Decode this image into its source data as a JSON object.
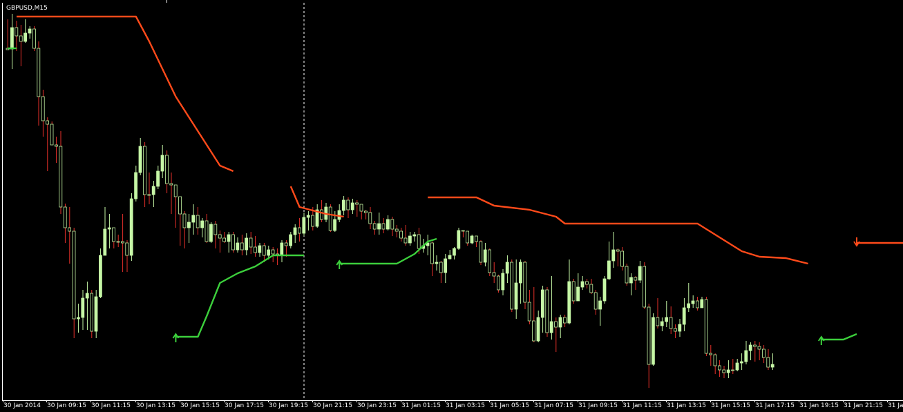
{
  "window": {
    "symbol_label": "GBPUSD,M15"
  },
  "colors": {
    "background": "#000000",
    "bull_candle": "#c6f7a6",
    "bear_candle": "#000000",
    "bull_wick": "#c6f7a6",
    "bear_wick": "#e8302a",
    "trend_down": "#ff4a1a",
    "trend_up": "#3ccf3c",
    "session_line": "#ffffff",
    "axis_text": "#ffffff"
  },
  "chart_data": {
    "type": "candlestick",
    "symbol": "GBPUSD",
    "timeframe": "M15",
    "grid": false,
    "x_tick_labels": [
      "30 Jan 2014",
      "30 Jan 09:15",
      "30 Jan 11:15",
      "30 Jan 13:15",
      "30 Jan 15:15",
      "30 Jan 17:15",
      "30 Jan 19:15",
      "30 Jan 21:15",
      "30 Jan 23:15",
      "31 Jan 01:15",
      "31 Jan 03:15",
      "31 Jan 05:15",
      "31 Jan 07:15",
      "31 Jan 09:15",
      "31 Jan 11:15",
      "31 Jan 13:15",
      "31 Jan 15:15",
      "31 Jan 17:15",
      "31 Jan 19:15",
      "31 Jan 21:15",
      "31 Ja"
    ],
    "y_range": [
      440,
      10
    ],
    "session_separator_bar": 67,
    "candles": [
      [
        70,
        72,
        28,
        71
      ],
      [
        71,
        40,
        20,
        100
      ],
      [
        40,
        52,
        30,
        74
      ],
      [
        52,
        60,
        36,
        96
      ],
      [
        60,
        48,
        28,
        62
      ],
      [
        48,
        42,
        38,
        56
      ],
      [
        42,
        70,
        38,
        74
      ],
      [
        70,
        140,
        60,
        182
      ],
      [
        140,
        175,
        130,
        198
      ],
      [
        175,
        180,
        170,
        248
      ],
      [
        180,
        210,
        176,
        210
      ],
      [
        210,
        212,
        198,
        236
      ],
      [
        212,
        300,
        190,
        310
      ],
      [
        300,
        330,
        295,
        352
      ],
      [
        330,
        335,
        300,
        382
      ],
      [
        335,
        462,
        330,
        490
      ],
      [
        462,
        460,
        440,
        482
      ],
      [
        460,
        432,
        420,
        478
      ],
      [
        432,
        425,
        408,
        478
      ],
      [
        425,
        480,
        420,
        490
      ],
      [
        480,
        430,
        420,
        490
      ],
      [
        430,
        370,
        360,
        432
      ],
      [
        370,
        332,
        300,
        370
      ],
      [
        332,
        330,
        310,
        360
      ],
      [
        330,
        350,
        330,
        360
      ],
      [
        350,
        350,
        340,
        358
      ],
      [
        350,
        352,
        310,
        394
      ],
      [
        352,
        370,
        348,
        394
      ],
      [
        370,
        288,
        280,
        378
      ],
      [
        288,
        250,
        240,
        292
      ],
      [
        250,
        212,
        200,
        254
      ],
      [
        212,
        282,
        206,
        300
      ],
      [
        282,
        282,
        250,
        296
      ],
      [
        282,
        270,
        262,
        300
      ],
      [
        270,
        248,
        240,
        274
      ],
      [
        248,
        225,
        210,
        258
      ],
      [
        225,
        266,
        218,
        280
      ],
      [
        266,
        268,
        250,
        310
      ],
      [
        268,
        285,
        280,
        330
      ],
      [
        285,
        310,
        300,
        356
      ],
      [
        310,
        330,
        306,
        360
      ],
      [
        330,
        322,
        310,
        352
      ],
      [
        322,
        312,
        296,
        340
      ],
      [
        312,
        330,
        300,
        340
      ],
      [
        330,
        320,
        316,
        344
      ],
      [
        320,
        350,
        310,
        352
      ],
      [
        350,
        325,
        322,
        352
      ],
      [
        325,
        340,
        320,
        360
      ],
      [
        340,
        345,
        334,
        366
      ],
      [
        345,
        350,
        336,
        352
      ],
      [
        350,
        340,
        336,
        366
      ],
      [
        340,
        362,
        336,
        366
      ],
      [
        362,
        352,
        344,
        366
      ],
      [
        352,
        362,
        340,
        370
      ],
      [
        362,
        345,
        338,
        370
      ],
      [
        345,
        358,
        336,
        368
      ],
      [
        358,
        366,
        342,
        372
      ],
      [
        366,
        356,
        352,
        372
      ],
      [
        356,
        370,
        352,
        380
      ],
      [
        370,
        362,
        356,
        376
      ],
      [
        362,
        368,
        358,
        380
      ],
      [
        368,
        370,
        360,
        384
      ],
      [
        370,
        352,
        348,
        380
      ],
      [
        352,
        356,
        348,
        372
      ],
      [
        356,
        340,
        336,
        360
      ],
      [
        340,
        330,
        325,
        352
      ],
      [
        330,
        338,
        316,
        350
      ],
      [
        338,
        315,
        308,
        342
      ],
      [
        315,
        312,
        306,
        334
      ],
      [
        312,
        328,
        300,
        334
      ],
      [
        328,
        304,
        296,
        330
      ],
      [
        304,
        318,
        290,
        322
      ],
      [
        318,
        300,
        294,
        322
      ],
      [
        300,
        334,
        296,
        336
      ],
      [
        334,
        318,
        306,
        336
      ],
      [
        318,
        305,
        296,
        322
      ],
      [
        305,
        290,
        284,
        312
      ],
      [
        290,
        304,
        286,
        316
      ],
      [
        304,
        294,
        288,
        310
      ],
      [
        294,
        296,
        290,
        314
      ],
      [
        296,
        306,
        296,
        318
      ],
      [
        306,
        308,
        304,
        318
      ],
      [
        308,
        324,
        300,
        332
      ],
      [
        324,
        332,
        320,
        340
      ],
      [
        332,
        324,
        308,
        340
      ],
      [
        324,
        332,
        316,
        338
      ],
      [
        332,
        318,
        312,
        334
      ],
      [
        318,
        332,
        314,
        342
      ],
      [
        332,
        335,
        326,
        344
      ],
      [
        335,
        345,
        330,
        350
      ],
      [
        345,
        352,
        326,
        356
      ],
      [
        352,
        342,
        336,
        356
      ],
      [
        342,
        340,
        336,
        350
      ],
      [
        340,
        360,
        330,
        368
      ],
      [
        360,
        356,
        346,
        366
      ],
      [
        356,
        352,
        340,
        370
      ],
      [
        352,
        382,
        350,
        400
      ],
      [
        382,
        380,
        370,
        392
      ],
      [
        380,
        395,
        378,
        410
      ],
      [
        395,
        375,
        368,
        410
      ],
      [
        375,
        370,
        362,
        376
      ],
      [
        370,
        360,
        358,
        376
      ],
      [
        360,
        334,
        330,
        362
      ],
      [
        334,
        335,
        334,
        344
      ],
      [
        335,
        352,
        336,
        356
      ],
      [
        352,
        342,
        340,
        354
      ],
      [
        342,
        350,
        346,
        358
      ],
      [
        350,
        380,
        348,
        384
      ],
      [
        380,
        362,
        352,
        386
      ],
      [
        362,
        395,
        360,
        400
      ],
      [
        395,
        400,
        380,
        410
      ],
      [
        400,
        420,
        398,
        424
      ],
      [
        420,
        396,
        390,
        428
      ],
      [
        396,
        380,
        370,
        410
      ],
      [
        380,
        448,
        376,
        452
      ],
      [
        448,
        410,
        376,
        462
      ],
      [
        410,
        380,
        376,
        440
      ],
      [
        380,
        438,
        378,
        448
      ],
      [
        438,
        465,
        420,
        470
      ],
      [
        465,
        494,
        416,
        496
      ],
      [
        494,
        460,
        450,
        496
      ],
      [
        460,
        420,
        414,
        482
      ],
      [
        420,
        482,
        416,
        488
      ],
      [
        482,
        466,
        400,
        492
      ],
      [
        466,
        474,
        460,
        510
      ],
      [
        474,
        460,
        456,
        490
      ],
      [
        460,
        468,
        456,
        474
      ],
      [
        468,
        408,
        376,
        470
      ],
      [
        408,
        436,
        404,
        440
      ],
      [
        436,
        416,
        396,
        436
      ],
      [
        416,
        408,
        400,
        420
      ],
      [
        408,
        412,
        404,
        418
      ],
      [
        412,
        424,
        404,
        426
      ],
      [
        424,
        448,
        420,
        456
      ],
      [
        448,
        436,
        430,
        472
      ],
      [
        436,
        404,
        400,
        440
      ],
      [
        404,
        378,
        350,
        406
      ],
      [
        378,
        362,
        336,
        388
      ],
      [
        362,
        364,
        360,
        386
      ],
      [
        364,
        386,
        358,
        392
      ],
      [
        386,
        410,
        382,
        414
      ],
      [
        410,
        402,
        396,
        428
      ],
      [
        402,
        406,
        400,
        420
      ],
      [
        406,
        386,
        378,
        410
      ],
      [
        386,
        445,
        380,
        448
      ],
      [
        445,
        528,
        440,
        562
      ],
      [
        528,
        460,
        454,
        530
      ],
      [
        460,
        472,
        432,
        476
      ],
      [
        472,
        466,
        460,
        480
      ],
      [
        466,
        460,
        436,
        474
      ],
      [
        460,
        476,
        444,
        484
      ],
      [
        476,
        480,
        470,
        490
      ],
      [
        480,
        470,
        462,
        488
      ],
      [
        470,
        446,
        432,
        480
      ],
      [
        446,
        440,
        410,
        452
      ],
      [
        440,
        436,
        428,
        446
      ],
      [
        436,
        446,
        430,
        450
      ],
      [
        446,
        434,
        430,
        446
      ],
      [
        434,
        512,
        430,
        516
      ],
      [
        512,
        514,
        500,
        530
      ],
      [
        514,
        530,
        512,
        542
      ],
      [
        530,
        536,
        522,
        546
      ],
      [
        536,
        540,
        530,
        548
      ],
      [
        540,
        536,
        522,
        548
      ],
      [
        536,
        536,
        520,
        542
      ],
      [
        536,
        526,
        520,
        538
      ],
      [
        526,
        524,
        512,
        536
      ],
      [
        524,
        508,
        494,
        528
      ],
      [
        508,
        500,
        496,
        522
      ],
      [
        500,
        502,
        494,
        524
      ],
      [
        502,
        506,
        496,
        522
      ],
      [
        506,
        518,
        500,
        526
      ],
      [
        518,
        532,
        506,
        536
      ],
      [
        532,
        528,
        512,
        536
      ]
    ],
    "indicators": [
      {
        "type": "trailing_stop_down",
        "color": "#ff4a1a",
        "segments": [
          [
            [
              2,
              24
            ],
            [
              29,
              24
            ],
            [
              32,
              60
            ],
            [
              38,
              140
            ],
            [
              44,
              200
            ],
            [
              48,
              240
            ],
            [
              51,
              248
            ]
          ],
          [
            [
              64,
              270
            ],
            [
              66,
              300
            ],
            [
              72,
              310
            ],
            [
              76,
              314
            ]
          ],
          [
            [
              95,
              286
            ],
            [
              106,
              286
            ],
            [
              110,
              298
            ],
            [
              118,
              304
            ],
            [
              124,
              314
            ],
            [
              126,
              324
            ],
            [
              146,
              324
            ],
            [
              156,
              324
            ],
            [
              160,
              340
            ],
            [
              166,
              364
            ],
            [
              170,
              372
            ],
            [
              176,
              374
            ],
            [
              181,
              382
            ]
          ],
          [
            [
              192,
              352
            ],
            [
              212,
              352
            ],
            [
              216,
              370
            ],
            [
              222,
              398
            ],
            [
              228,
              414
            ],
            [
              236,
              424
            ]
          ]
        ]
      },
      {
        "type": "trailing_stop_up",
        "color": "#3ccf3c",
        "segments": [
          [
            [
              0,
              70
            ],
            [
              2,
              70
            ]
          ],
          [
            [
              38,
              488
            ],
            [
              43,
              488
            ],
            [
              45,
              458
            ],
            [
              48,
              410
            ],
            [
              52,
              396
            ],
            [
              56,
              386
            ],
            [
              60,
              370
            ],
            [
              66,
              370
            ],
            [
              67,
              370
            ]
          ],
          [
            [
              75,
              382
            ],
            [
              88,
              382
            ],
            [
              92,
              368
            ],
            [
              95,
              350
            ],
            [
              97,
              346
            ]
          ],
          [
            [
              184,
              492
            ],
            [
              189,
              492
            ],
            [
              192,
              484
            ]
          ]
        ]
      }
    ]
  }
}
